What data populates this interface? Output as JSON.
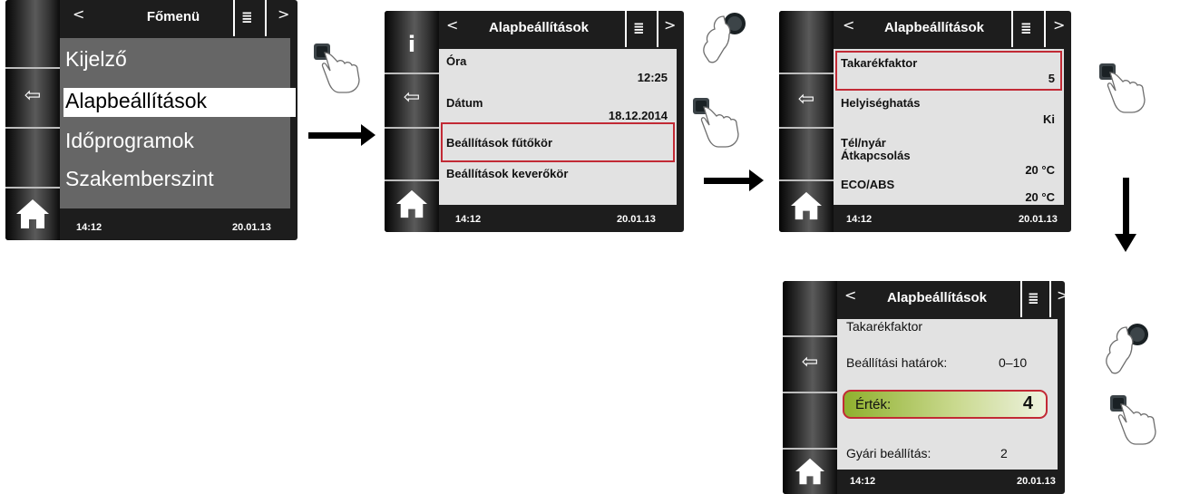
{
  "common": {
    "time": "14:12",
    "date": "20.01.13",
    "nav_prev": "<",
    "nav_next": ">",
    "back_icon": "⇦",
    "info_icon": "i",
    "menu_icon": "≣"
  },
  "screen1": {
    "title": "Főmenü",
    "items": [
      "Kijelző",
      "Alapbeállítások",
      "Időprogramok",
      "Szakemberszint"
    ]
  },
  "screen2": {
    "title": "Alapbeállítások",
    "rows": [
      {
        "label": "Óra",
        "value": "12:25"
      },
      {
        "label": "Dátum",
        "value": "18.12.2014"
      },
      {
        "label": "Beállítások fűtőkör",
        "value": ""
      },
      {
        "label": "Beállítások keverőkör",
        "value": ""
      }
    ]
  },
  "screen3": {
    "title": "Alapbeállítások",
    "rows": [
      {
        "label": "Takarékfaktor",
        "value": "5"
      },
      {
        "label": "Helyiséghatás",
        "value": "Ki"
      },
      {
        "label": "Tél/nyár",
        "label2": "Átkapcsolás",
        "value": "20 °C"
      },
      {
        "label": "ECO/ABS",
        "value": "20 °C"
      }
    ]
  },
  "screen4": {
    "title": "Alapbeállítások",
    "param": "Takarékfaktor",
    "limits_label": "Beállítási határok:",
    "limits_value": "0–10",
    "value_label": "Érték:",
    "value": "4",
    "default_label": "Gyári beállítás:",
    "default_value": "2"
  },
  "colors": {
    "highlight": "#c22a35",
    "screen_bg": "#1d1d1d",
    "content_bg": "#e2e2e2",
    "value_gradient_start": "#8fb02e"
  }
}
